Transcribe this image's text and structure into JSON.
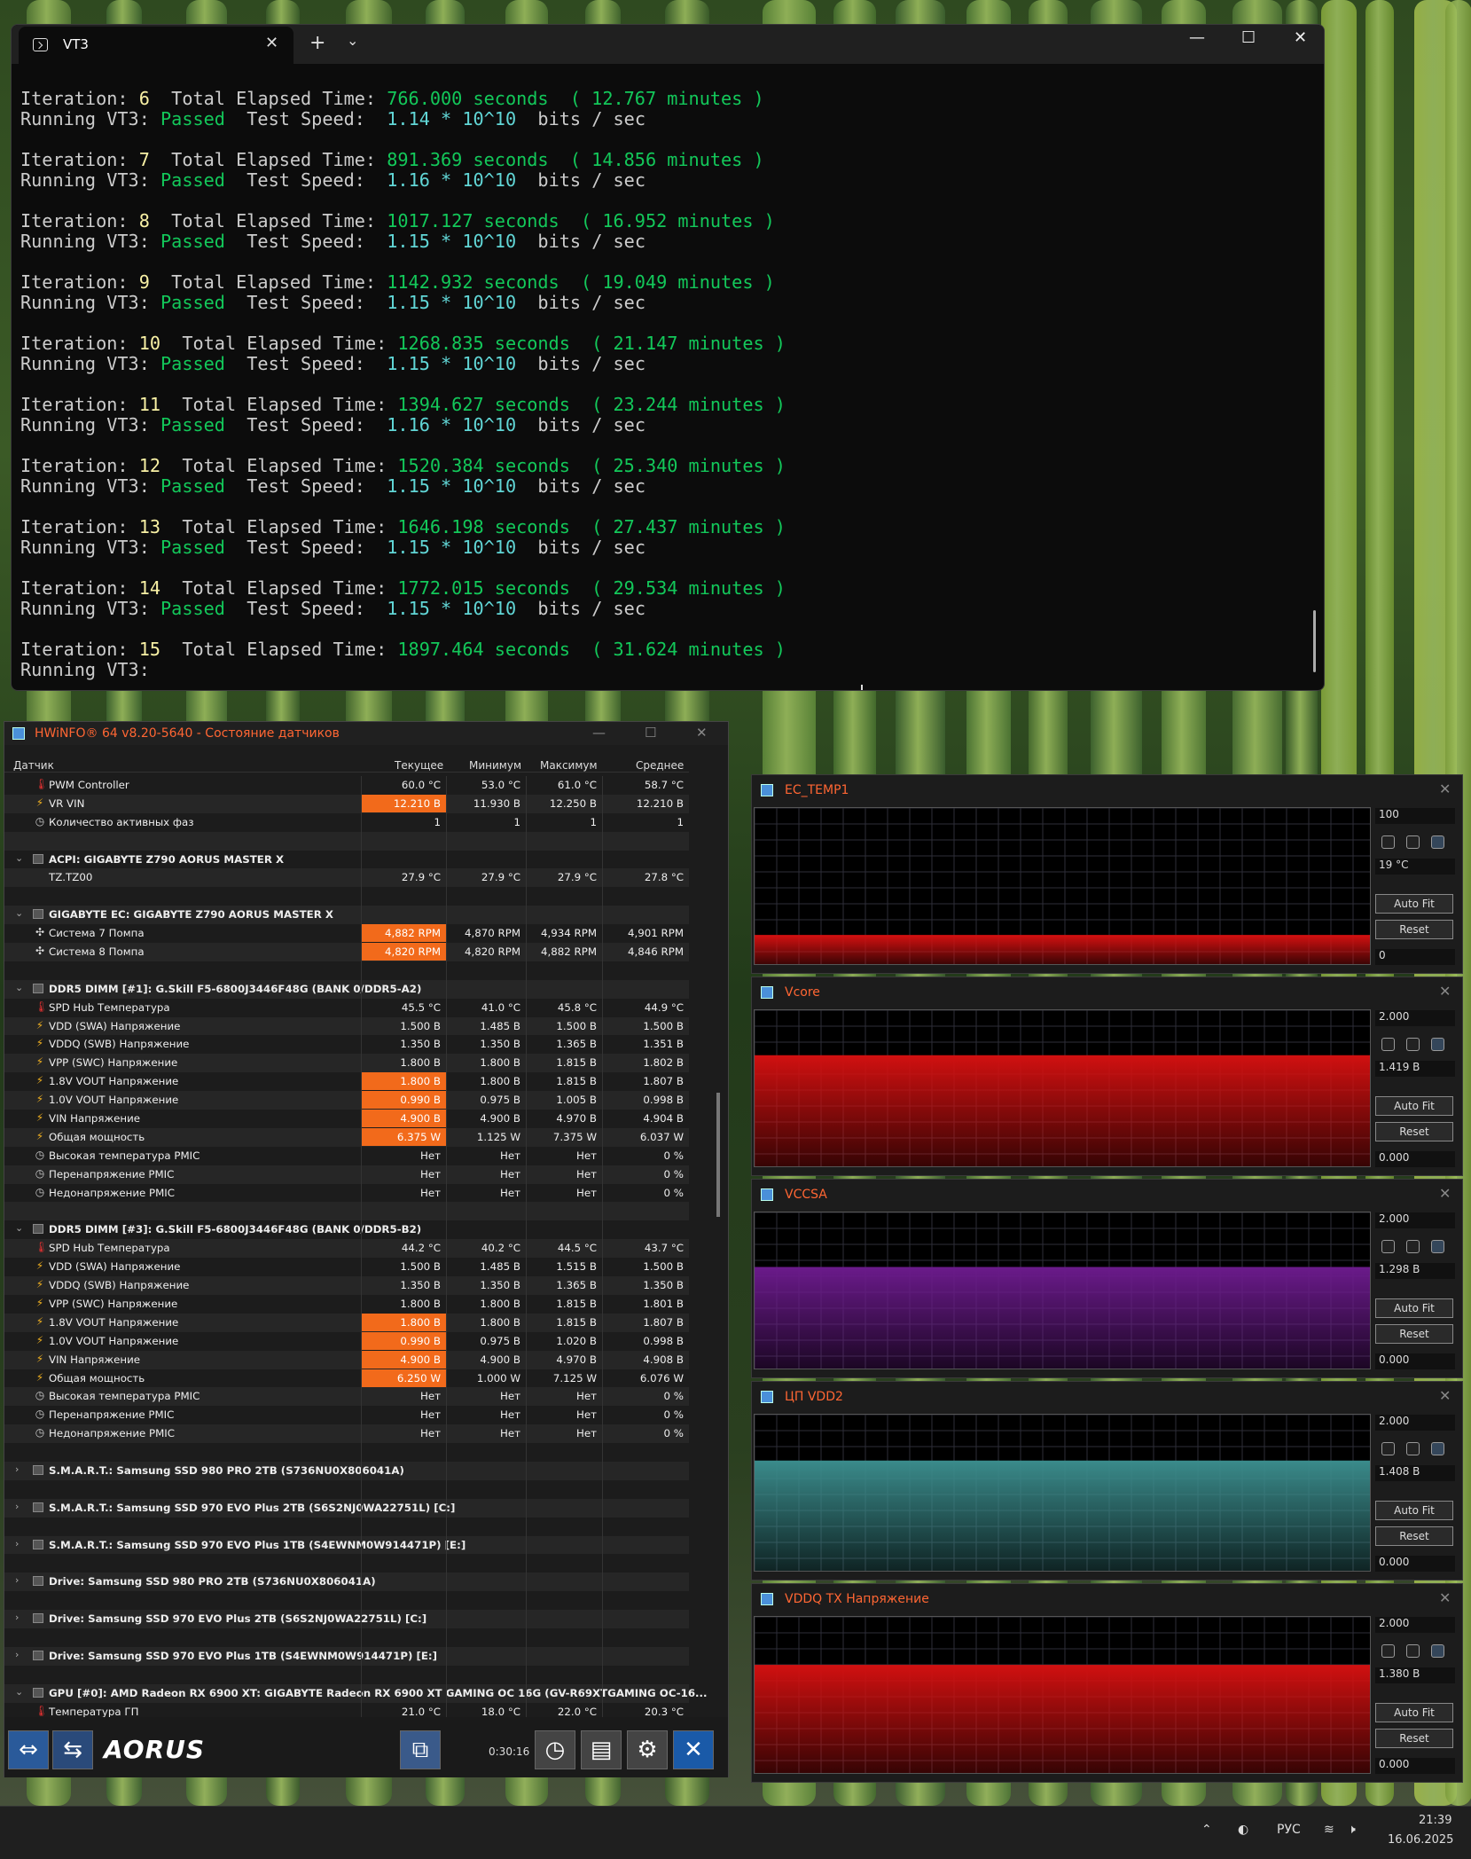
{
  "terminal": {
    "tab_title": "VT3",
    "new_tab": "+",
    "dropdown": "⌄",
    "minimize": "—",
    "maximize": "☐",
    "close": "✕",
    "label_iteration": "Iteration:",
    "label_total": "Total Elapsed Time:",
    "label_running": "Running VT3:",
    "label_speed": "Test Speed:",
    "unit_seconds": "seconds",
    "unit_minutes": "minutes",
    "unit_bits": "bits / sec",
    "iterations": [
      {
        "n": "6",
        "seconds": "766.000",
        "minutes": "12.767",
        "status": "Passed",
        "speed": "1.14 * 10^10"
      },
      {
        "n": "7",
        "seconds": "891.369",
        "minutes": "14.856",
        "status": "Passed",
        "speed": "1.16 * 10^10"
      },
      {
        "n": "8",
        "seconds": "1017.127",
        "minutes": "16.952",
        "status": "Passed",
        "speed": "1.15 * 10^10"
      },
      {
        "n": "9",
        "seconds": "1142.932",
        "minutes": "19.049",
        "status": "Passed",
        "speed": "1.15 * 10^10"
      },
      {
        "n": "10",
        "seconds": "1268.835",
        "minutes": "21.147",
        "status": "Passed",
        "speed": "1.15 * 10^10"
      },
      {
        "n": "11",
        "seconds": "1394.627",
        "minutes": "23.244",
        "status": "Passed",
        "speed": "1.16 * 10^10"
      },
      {
        "n": "12",
        "seconds": "1520.384",
        "minutes": "25.340",
        "status": "Passed",
        "speed": "1.15 * 10^10"
      },
      {
        "n": "13",
        "seconds": "1646.198",
        "minutes": "27.437",
        "status": "Passed",
        "speed": "1.15 * 10^10"
      },
      {
        "n": "14",
        "seconds": "1772.015",
        "minutes": "29.534",
        "status": "Passed",
        "speed": "1.15 * 10^10"
      },
      {
        "n": "15",
        "seconds": "1897.464",
        "minutes": "31.624",
        "status": "",
        "speed": ""
      }
    ]
  },
  "hwinfo": {
    "title": "HWiNFO® 64 v8.20-5640 - Состояние датчиков",
    "columns": [
      "Датчик",
      "Текущее",
      "Минимум",
      "Максимум",
      "Среднее"
    ],
    "rows": [
      {
        "type": "s",
        "icon": "thermometer-icon",
        "name": "PWM Controller",
        "v": [
          "60.0 °C",
          "53.0 °C",
          "61.0 °C",
          "58.7 °C"
        ]
      },
      {
        "type": "s",
        "icon": "voltage-icon",
        "name": "VR VIN",
        "v": [
          "12.210 В",
          "11.930 В",
          "12.250 В",
          "12.210 В"
        ],
        "hl": true
      },
      {
        "type": "s",
        "icon": "clock-icon",
        "name": "Количество активных фаз",
        "v": [
          "1",
          "1",
          "1",
          "1"
        ]
      },
      {
        "type": "e"
      },
      {
        "type": "g",
        "name": "ACPI: GIGABYTE Z790 AORUS MASTER X"
      },
      {
        "type": "s",
        "icon": "none",
        "name": "TZ.TZ00",
        "v": [
          "27.9 °C",
          "27.9 °C",
          "27.9 °C",
          "27.8 °C"
        ]
      },
      {
        "type": "e"
      },
      {
        "type": "g",
        "name": "GIGABYTE EC: GIGABYTE Z790 AORUS MASTER X"
      },
      {
        "type": "s",
        "icon": "fan-icon",
        "name": "Система 7 Помпа",
        "v": [
          "4,882 RPM",
          "4,870 RPM",
          "4,934 RPM",
          "4,901 RPM"
        ],
        "hl": true
      },
      {
        "type": "s",
        "icon": "fan-icon",
        "name": "Система 8 Помпа",
        "v": [
          "4,820 RPM",
          "4,820 RPM",
          "4,882 RPM",
          "4,846 RPM"
        ],
        "hl": true
      },
      {
        "type": "e"
      },
      {
        "type": "g",
        "name": "DDR5 DIMM [#1]: G.Skill F5-6800J3446F48G (BANK 0/DDR5-A2)"
      },
      {
        "type": "s",
        "icon": "thermometer-icon",
        "name": "SPD Hub Температура",
        "v": [
          "45.5 °C",
          "41.0 °C",
          "45.8 °C",
          "44.9 °C"
        ]
      },
      {
        "type": "s",
        "icon": "voltage-icon",
        "name": "VDD (SWA) Напряжение",
        "v": [
          "1.500 В",
          "1.485 В",
          "1.500 В",
          "1.500 В"
        ]
      },
      {
        "type": "s",
        "icon": "voltage-icon",
        "name": "VDDQ (SWB) Напряжение",
        "v": [
          "1.350 В",
          "1.350 В",
          "1.365 В",
          "1.351 В"
        ]
      },
      {
        "type": "s",
        "icon": "voltage-icon",
        "name": "VPP (SWC) Напряжение",
        "v": [
          "1.800 В",
          "1.800 В",
          "1.815 В",
          "1.802 В"
        ]
      },
      {
        "type": "s",
        "icon": "voltage-icon",
        "name": "1.8V VOUT Напряжение",
        "v": [
          "1.800 В",
          "1.800 В",
          "1.815 В",
          "1.807 В"
        ],
        "hl": true
      },
      {
        "type": "s",
        "icon": "voltage-icon",
        "name": "1.0V VOUT Напряжение",
        "v": [
          "0.990 В",
          "0.975 В",
          "1.005 В",
          "0.998 В"
        ],
        "hl": true
      },
      {
        "type": "s",
        "icon": "voltage-icon",
        "name": "VIN Напряжение",
        "v": [
          "4.900 В",
          "4.900 В",
          "4.970 В",
          "4.904 В"
        ],
        "hl": true
      },
      {
        "type": "s",
        "icon": "voltage-icon",
        "name": "Общая мощность",
        "v": [
          "6.375 W",
          "1.125 W",
          "7.375 W",
          "6.037 W"
        ],
        "hl": true
      },
      {
        "type": "s",
        "icon": "clock-icon",
        "name": "Высокая температура PMIC",
        "v": [
          "Нет",
          "Нет",
          "Нет",
          "0 %"
        ]
      },
      {
        "type": "s",
        "icon": "clock-icon",
        "name": "Перенапряжение PMIC",
        "v": [
          "Нет",
          "Нет",
          "Нет",
          "0 %"
        ]
      },
      {
        "type": "s",
        "icon": "clock-icon",
        "name": "Недонапряжение PMIC",
        "v": [
          "Нет",
          "Нет",
          "Нет",
          "0 %"
        ]
      },
      {
        "type": "e"
      },
      {
        "type": "g",
        "name": "DDR5 DIMM [#3]: G.Skill F5-6800J3446F48G (BANK 0/DDR5-B2)"
      },
      {
        "type": "s",
        "icon": "thermometer-icon",
        "name": "SPD Hub Температура",
        "v": [
          "44.2 °C",
          "40.2 °C",
          "44.5 °C",
          "43.7 °C"
        ]
      },
      {
        "type": "s",
        "icon": "voltage-icon",
        "name": "VDD (SWA) Напряжение",
        "v": [
          "1.500 В",
          "1.485 В",
          "1.515 В",
          "1.500 В"
        ]
      },
      {
        "type": "s",
        "icon": "voltage-icon",
        "name": "VDDQ (SWB) Напряжение",
        "v": [
          "1.350 В",
          "1.350 В",
          "1.365 В",
          "1.350 В"
        ]
      },
      {
        "type": "s",
        "icon": "voltage-icon",
        "name": "VPP (SWC) Напряжение",
        "v": [
          "1.800 В",
          "1.800 В",
          "1.815 В",
          "1.801 В"
        ]
      },
      {
        "type": "s",
        "icon": "voltage-icon",
        "name": "1.8V VOUT Напряжение",
        "v": [
          "1.800 В",
          "1.800 В",
          "1.815 В",
          "1.807 В"
        ],
        "hl": true
      },
      {
        "type": "s",
        "icon": "voltage-icon",
        "name": "1.0V VOUT Напряжение",
        "v": [
          "0.990 В",
          "0.975 В",
          "1.020 В",
          "0.998 В"
        ],
        "hl": true
      },
      {
        "type": "s",
        "icon": "voltage-icon",
        "name": "VIN Напряжение",
        "v": [
          "4.900 В",
          "4.900 В",
          "4.970 В",
          "4.908 В"
        ],
        "hl": true
      },
      {
        "type": "s",
        "icon": "voltage-icon",
        "name": "Общая мощность",
        "v": [
          "6.250 W",
          "1.000 W",
          "7.125 W",
          "6.076 W"
        ],
        "hl": true
      },
      {
        "type": "s",
        "icon": "clock-icon",
        "name": "Высокая температура PMIC",
        "v": [
          "Нет",
          "Нет",
          "Нет",
          "0 %"
        ]
      },
      {
        "type": "s",
        "icon": "clock-icon",
        "name": "Перенапряжение PMIC",
        "v": [
          "Нет",
          "Нет",
          "Нет",
          "0 %"
        ]
      },
      {
        "type": "s",
        "icon": "clock-icon",
        "name": "Недонапряжение PMIC",
        "v": [
          "Нет",
          "Нет",
          "Нет",
          "0 %"
        ]
      },
      {
        "type": "e"
      },
      {
        "type": "gc",
        "name": "S.M.A.R.T.: Samsung SSD 980 PRO 2TB (S736NU0X806041A)"
      },
      {
        "type": "e"
      },
      {
        "type": "gc",
        "name": "S.M.A.R.T.: Samsung SSD 970 EVO Plus 2TB (S6S2NJ0WA22751L) [C:]"
      },
      {
        "type": "e"
      },
      {
        "type": "gc",
        "name": "S.M.A.R.T.: Samsung SSD 970 EVO Plus 1TB (S4EWNM0W914471P) [E:]"
      },
      {
        "type": "e"
      },
      {
        "type": "gc",
        "name": "Drive: Samsung SSD 980 PRO 2TB (S736NU0X806041A)"
      },
      {
        "type": "e"
      },
      {
        "type": "gc",
        "name": "Drive: Samsung SSD 970 EVO Plus 2TB (S6S2NJ0WA22751L) [C:]"
      },
      {
        "type": "e"
      },
      {
        "type": "gc",
        "name": "Drive: Samsung SSD 970 EVO Plus 1TB (S4EWNM0W914471P) [E:]"
      },
      {
        "type": "e"
      },
      {
        "type": "g",
        "name": "GPU [#0]: AMD Radeon RX 6900 XT: GIGABYTE Radeon RX 6900 XT GAMING OC 16G (GV-R69XTGAMING OC-16..."
      },
      {
        "type": "s",
        "icon": "thermometer-icon",
        "name": "Температура ГП",
        "v": [
          "21.0 °C",
          "18.0 °C",
          "22.0 °C",
          "20.3 °C"
        ]
      }
    ],
    "toolbar": {
      "logo": "AORUS",
      "timer": "0:30:16"
    }
  },
  "graphs": [
    {
      "name": "EC_TEMP1",
      "max": "100",
      "current": "19 °C",
      "min": "0",
      "level": 0.19,
      "color": "#d01010",
      "auto_fit": "Auto Fit",
      "reset": "Reset"
    },
    {
      "name": "Vcore",
      "max": "2.000",
      "current": "1.419 В",
      "min": "0.000",
      "level": 0.7095,
      "color": "#d01010",
      "auto_fit": "Auto Fit",
      "reset": "Reset"
    },
    {
      "name": "VCCSA",
      "max": "2.000",
      "current": "1.298 В",
      "min": "0.000",
      "level": 0.649,
      "color": "#6a1a8a",
      "auto_fit": "Auto Fit",
      "reset": "Reset"
    },
    {
      "name": "ЦП VDD2",
      "max": "2.000",
      "current": "1.408 В",
      "min": "0.000",
      "level": 0.704,
      "color": "#3a8a8a",
      "auto_fit": "Auto Fit",
      "reset": "Reset"
    },
    {
      "name": "VDDQ TX Напряжение",
      "max": "2.000",
      "current": "1.380 В",
      "min": "0.000",
      "level": 0.69,
      "color": "#d01010",
      "auto_fit": "Auto Fit",
      "reset": "Reset"
    }
  ],
  "taskbar": {
    "lang": "РУС",
    "time": "21:39",
    "date": "16.06.2025"
  }
}
